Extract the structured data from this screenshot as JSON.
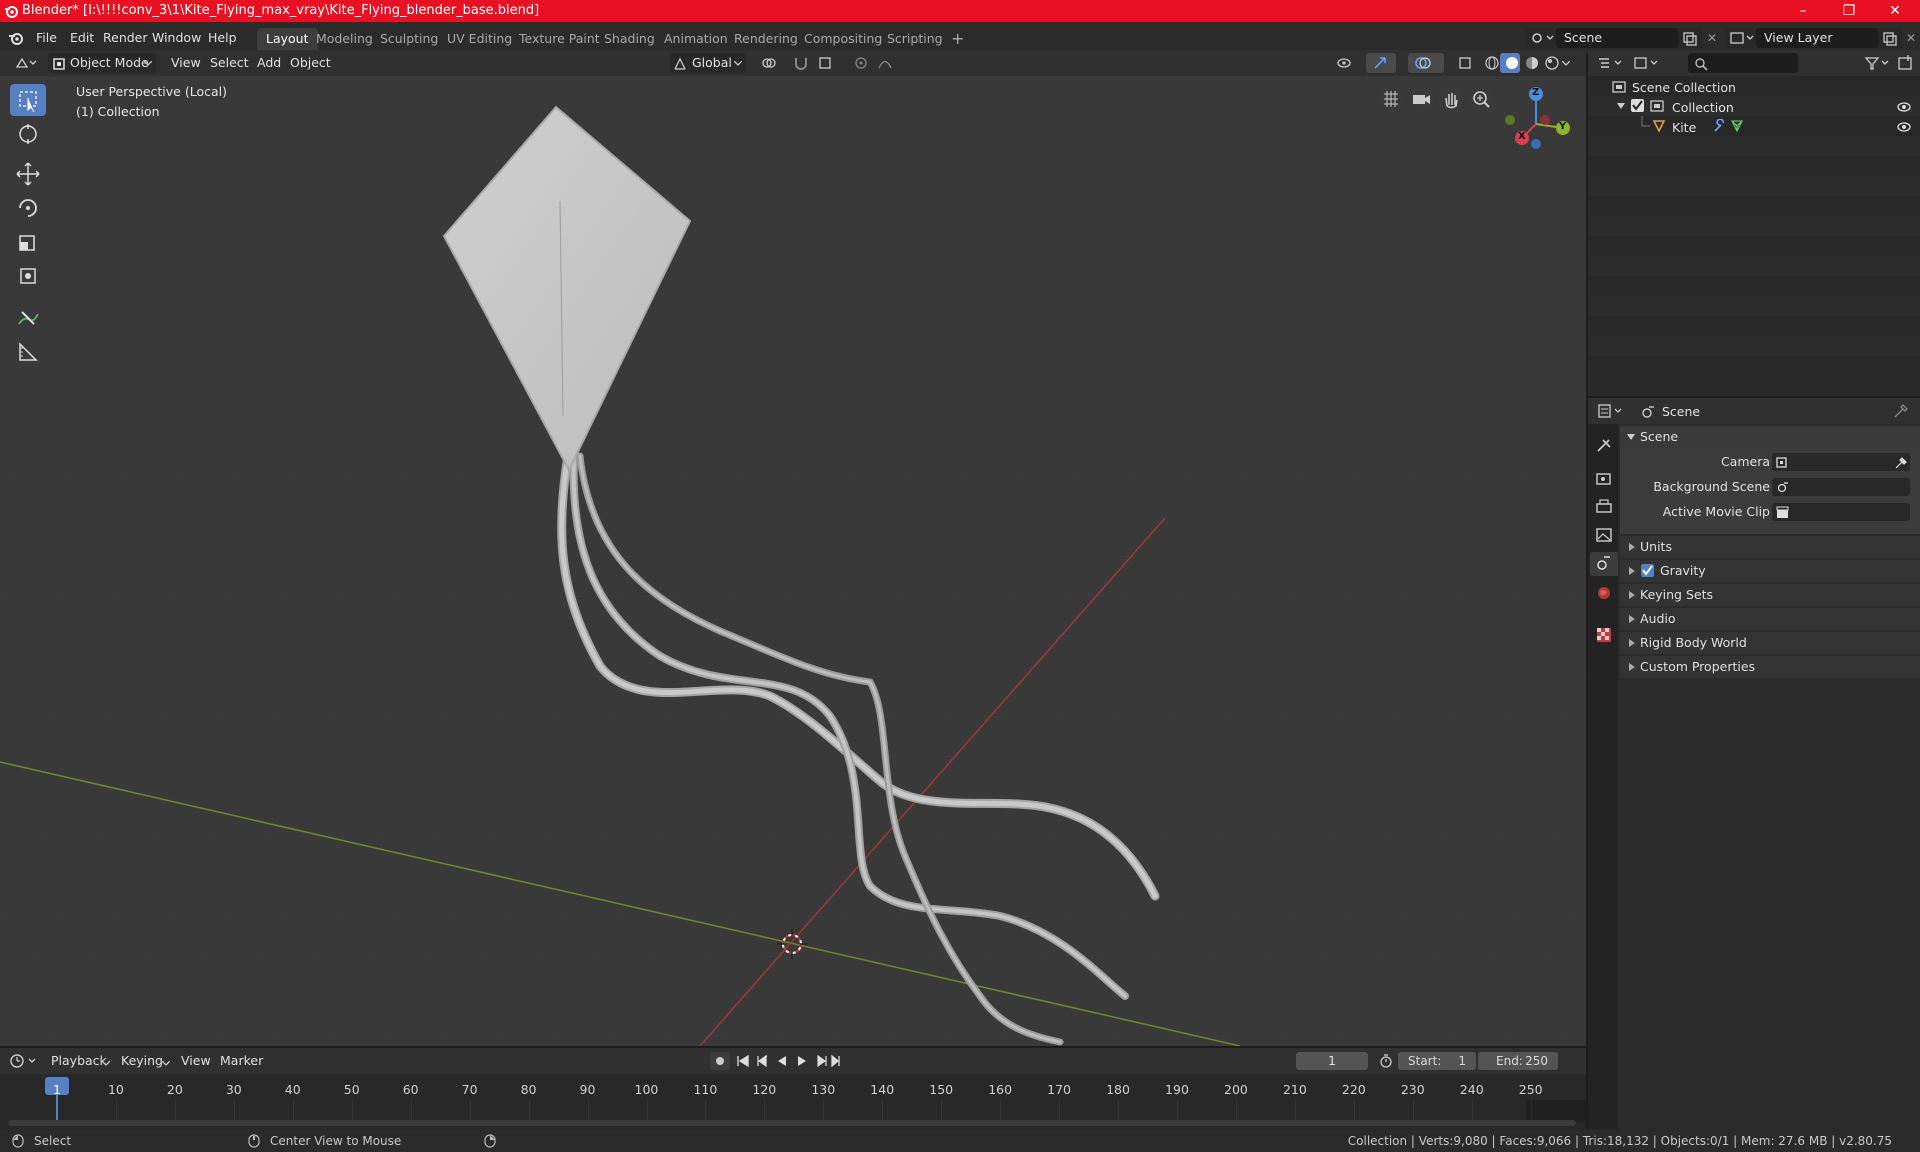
{
  "window": {
    "title": "Blender* [I:\\!!!!conv_3\\1\\Kite_Flying_max_vray\\Kite_Flying_blender_base.blend]",
    "controls": [
      "–",
      "❐",
      "✕"
    ]
  },
  "menubar": {
    "menus": [
      "File",
      "Edit",
      "Render",
      "Window",
      "Help"
    ],
    "workspaces": [
      "Layout",
      "Modeling",
      "Sculpting",
      "UV Editing",
      "Texture Paint",
      "Shading",
      "Animation",
      "Rendering",
      "Compositing",
      "Scripting"
    ],
    "active_workspace": "Layout",
    "add_workspace": "+",
    "scene_field": "Scene",
    "view_layer_field": "View Layer"
  },
  "viewport_header": {
    "mode": "Object Mode",
    "menus": [
      "View",
      "Select",
      "Add",
      "Object"
    ],
    "orientation": "Global"
  },
  "viewport": {
    "perspective_label": "User Perspective (Local)",
    "collection_label": "(1) Collection",
    "gizmo": {
      "x": "X",
      "y": "Y",
      "z": "Z"
    }
  },
  "outliner": {
    "search_placeholder": "",
    "root": "Scene Collection",
    "items": [
      {
        "label": "Collection",
        "level": 1
      },
      {
        "label": "Kite",
        "level": 2
      }
    ]
  },
  "properties": {
    "breadcrumb": "Scene",
    "panel_title": "Scene",
    "fields": [
      {
        "label": "Camera",
        "value": ""
      },
      {
        "label": "Background Scene",
        "value": ""
      },
      {
        "label": "Active Movie Clip",
        "value": ""
      }
    ],
    "sections": [
      "Units",
      "Gravity",
      "Keying Sets",
      "Audio",
      "Rigid Body World",
      "Custom Properties"
    ],
    "gravity_checked": true
  },
  "timeline": {
    "menus": [
      "Playback",
      "Keying",
      "View",
      "Marker"
    ],
    "current_frame": "1",
    "start_label": "Start:",
    "start_value": "1",
    "end_label": "End:",
    "end_value": "250",
    "ticks": [
      "1",
      "10",
      "20",
      "30",
      "40",
      "50",
      "60",
      "70",
      "80",
      "90",
      "100",
      "110",
      "120",
      "130",
      "140",
      "150",
      "160",
      "170",
      "180",
      "190",
      "200",
      "210",
      "220",
      "230",
      "240",
      "250"
    ]
  },
  "statusbar": {
    "left_action": "Select",
    "middle_action": "Center View to Mouse",
    "stats": "Collection | Verts:9,080 | Faces:9,066 | Tris:18,132 | Objects:0/1 | Mem: 27.6 MB | v2.80.75"
  },
  "colors": {
    "accent": "#5680c2",
    "titlebar": "#e81123",
    "x_axis": "#d8404f",
    "y_axis": "#8bb42c",
    "z_axis": "#4a8ce0"
  }
}
